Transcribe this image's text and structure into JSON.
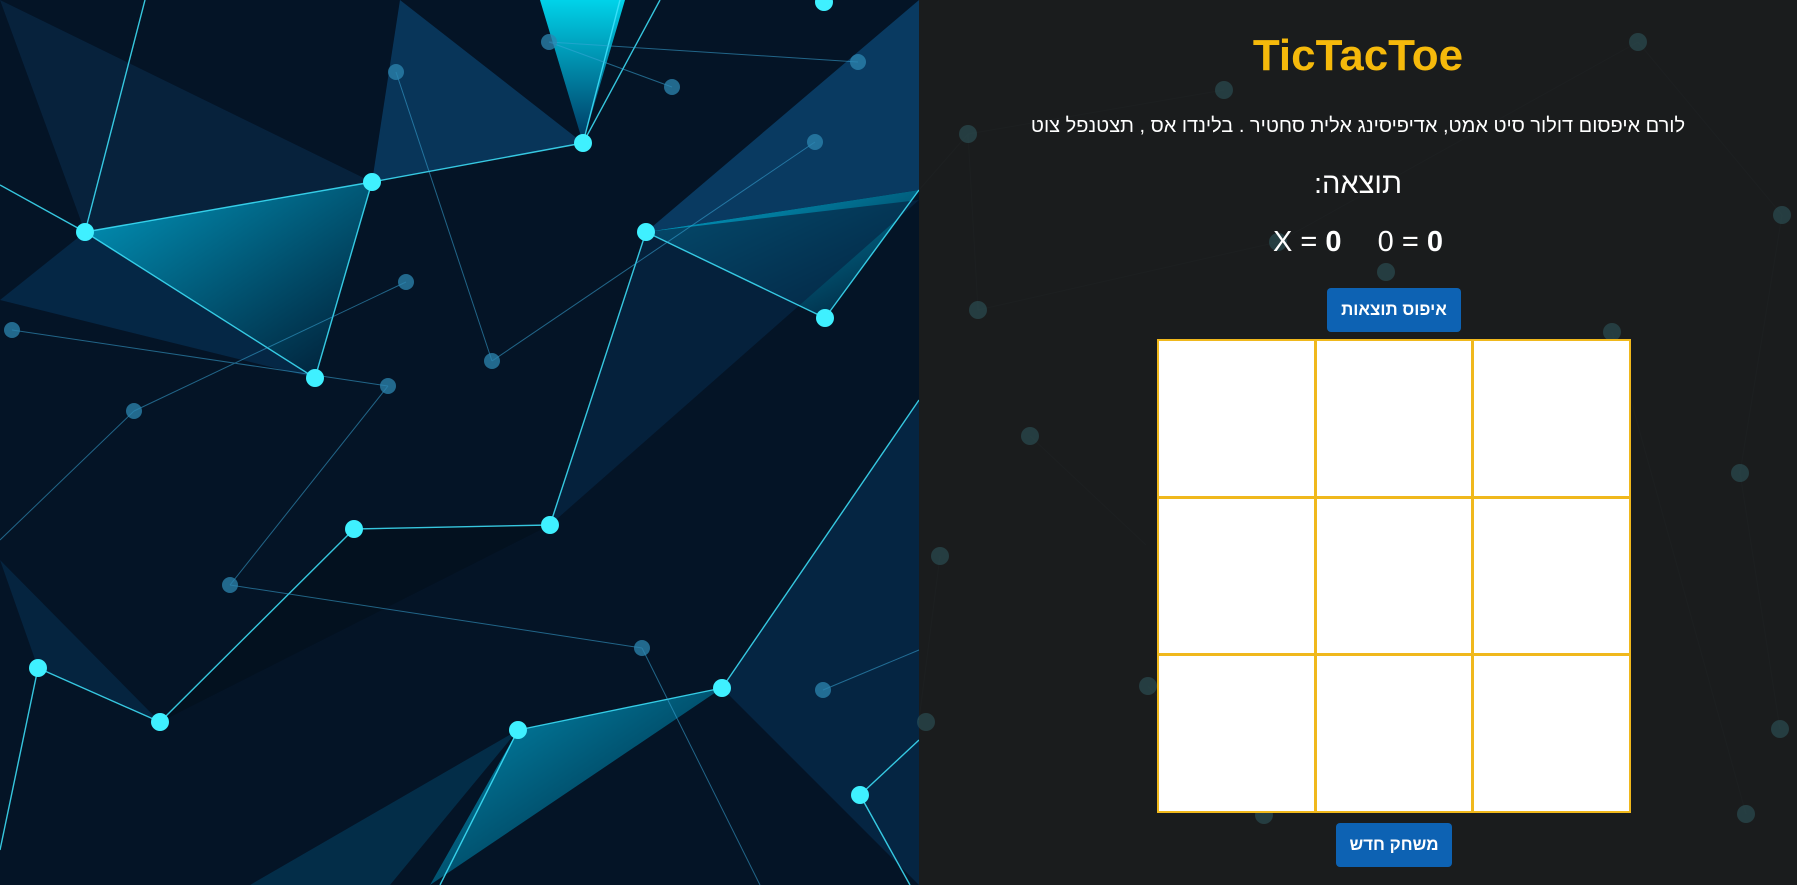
{
  "app": {
    "title": "TicTacToe",
    "description": "לורם איפסום דולור סיט אמט, אדיפיסינג אלית סחטיר . בלינדו אס , תצטנפל צוט",
    "score_label": "תוצאה:"
  },
  "scores": [
    {
      "symbol": "X",
      "value": "0"
    },
    {
      "symbol": "0",
      "value": "0"
    }
  ],
  "buttons": {
    "reset_scores": "איפוס תוצאות",
    "new_game": "משחק חדש"
  },
  "board": {
    "cells": [
      "",
      "",
      "",
      "",
      "",
      "",
      "",
      "",
      ""
    ]
  },
  "colors": {
    "accent": "#f5b90b",
    "button": "#0d62b3",
    "panel": "#1c1c1c",
    "background": "#0b1d33",
    "network": "#2fe6ff"
  }
}
